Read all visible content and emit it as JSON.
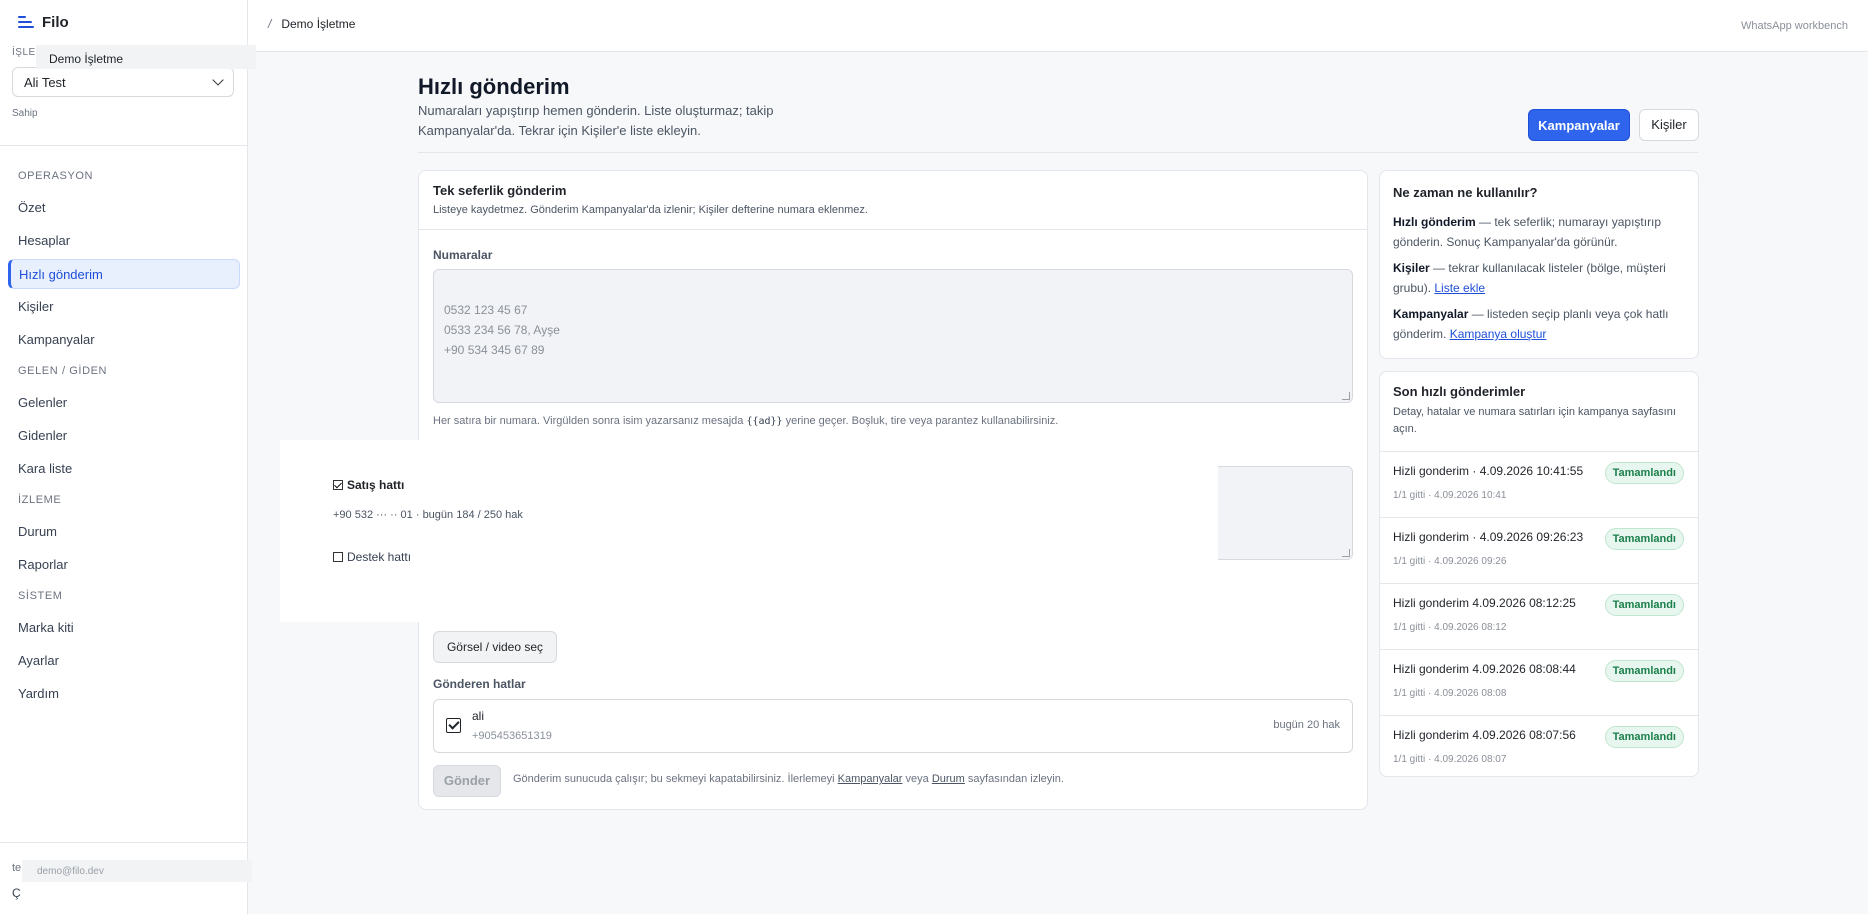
{
  "sidebar": {
    "brand": "Filo",
    "workspace_label": "İŞLE",
    "workspace_tooltip": "Demo İşletme",
    "workspace_select": "Ali Test",
    "role": "Sahip",
    "groups": [
      {
        "label": "OPERASYON",
        "items": [
          "Özet",
          "Hesaplar",
          "Hızlı gönderim",
          "Kişiler",
          "Kampanyalar"
        ]
      },
      {
        "label": "GELEN / GİDEN",
        "items": [
          "Gelenler",
          "Gidenler",
          "Kara liste"
        ]
      },
      {
        "label": "İZLEME",
        "items": [
          "Durum",
          "Raporlar"
        ]
      },
      {
        "label": "SİSTEM",
        "items": [
          "Marka kiti",
          "Ayarlar",
          "Yardım"
        ]
      }
    ],
    "active_item": "Hızlı gönderim",
    "footer_line1": "te",
    "footer_line2": "Ç",
    "email_tooltip": "demo@filo.dev"
  },
  "topbar": {
    "breadcrumb_sep": "/",
    "breadcrumb": "Demo İşletme",
    "right_label": "WhatsApp workbench"
  },
  "page": {
    "title": "Hızlı gönderim",
    "subtitle": "Numaraları yapıştırıp hemen gönderin. Liste oluşturmaz; takip Kampanyalar'da. Tekrar için Kişiler'e liste ekleyin.",
    "btn_campaigns": "Kampanyalar",
    "btn_contacts": "Kişiler"
  },
  "form": {
    "title": "Tek seferlik gönderim",
    "subtitle": "Listeye kaydetmez. Gönderim Kampanyalar'da izlenir; Kişiler defterine numara eklenmez.",
    "numbers_label": "Numaralar",
    "numbers_placeholder": "0532 123 45 67\n0533 234 56 78, Ayşe\n+90 534 345 67 89",
    "hint_before": "Her satıra bir numara. Virgülden sonra isim yazarsanız mesajda ",
    "hint_code": "{{ad}}",
    "hint_after": " yerine geçer. Boşluk, tire veya parantez kullanabilirsiniz.",
    "media_button": "Görsel / video seç",
    "senders_label": "Gönderen hatlar",
    "sender": {
      "name": "ali",
      "number": "+905453651319",
      "quota": "bugün 20 hak",
      "checked": true
    },
    "send_button": "Gönder",
    "send_note_1": "Gönderim sunucuda çalışır; bu sekmeyi kapatabilirsiniz. İlerlemeyi ",
    "send_link_1": "Kampanyalar",
    "send_note_2": " veya ",
    "send_link_2": "Durum",
    "send_note_3": " sayfasından izleyin."
  },
  "popover": {
    "line1": "Satış hattı",
    "line2": "+90 532 ··· ·· 01 · bugün 184 / 250 hak",
    "line3": "Destek hattı"
  },
  "info": {
    "title": "Ne zaman ne kullanılır?",
    "p1_bold": "Hızlı gönderim",
    "p1_text": " — tek seferlik; numarayı yapıştırıp gönderin. Sonuç Kampanyalar'da görünür.",
    "p2_bold": "Kişiler",
    "p2_text": " — tekrar kullanılacak listeler (bölge, müşteri grubu). ",
    "p2_link": "Liste ekle",
    "p3_bold": "Kampanyalar",
    "p3_text": " — listeden seçip planlı veya çok hatlı gönderim. ",
    "p3_link": "Kampanya oluştur"
  },
  "recent": {
    "title": "Son hızlı gönderimler",
    "subtitle": "Detay, hatalar ve numara satırları için kampanya sayfasını açın.",
    "rows": [
      {
        "name": "Hizli gonderim · 4.09.2026 10:41:55",
        "meta": "1/1 gitti · 4.09.2026 10:41",
        "status": "Tamamlandı"
      },
      {
        "name": "Hizli gonderim · 4.09.2026 09:26:23",
        "meta": "1/1 gitti · 4.09.2026 09:26",
        "status": "Tamamlandı"
      },
      {
        "name": "Hizli gonderim 4.09.2026 08:12:25",
        "meta": "1/1 gitti · 4.09.2026 08:12",
        "status": "Tamamlandı"
      },
      {
        "name": "Hizli gonderim 4.09.2026 08:08:44",
        "meta": "1/1 gitti · 4.09.2026 08:08",
        "status": "Tamamlandı"
      },
      {
        "name": "Hizli gonderim 4.09.2026 08:07:56",
        "meta": "1/1 gitti · 4.09.2026 08:07",
        "status": "Tamamlandı"
      }
    ]
  }
}
